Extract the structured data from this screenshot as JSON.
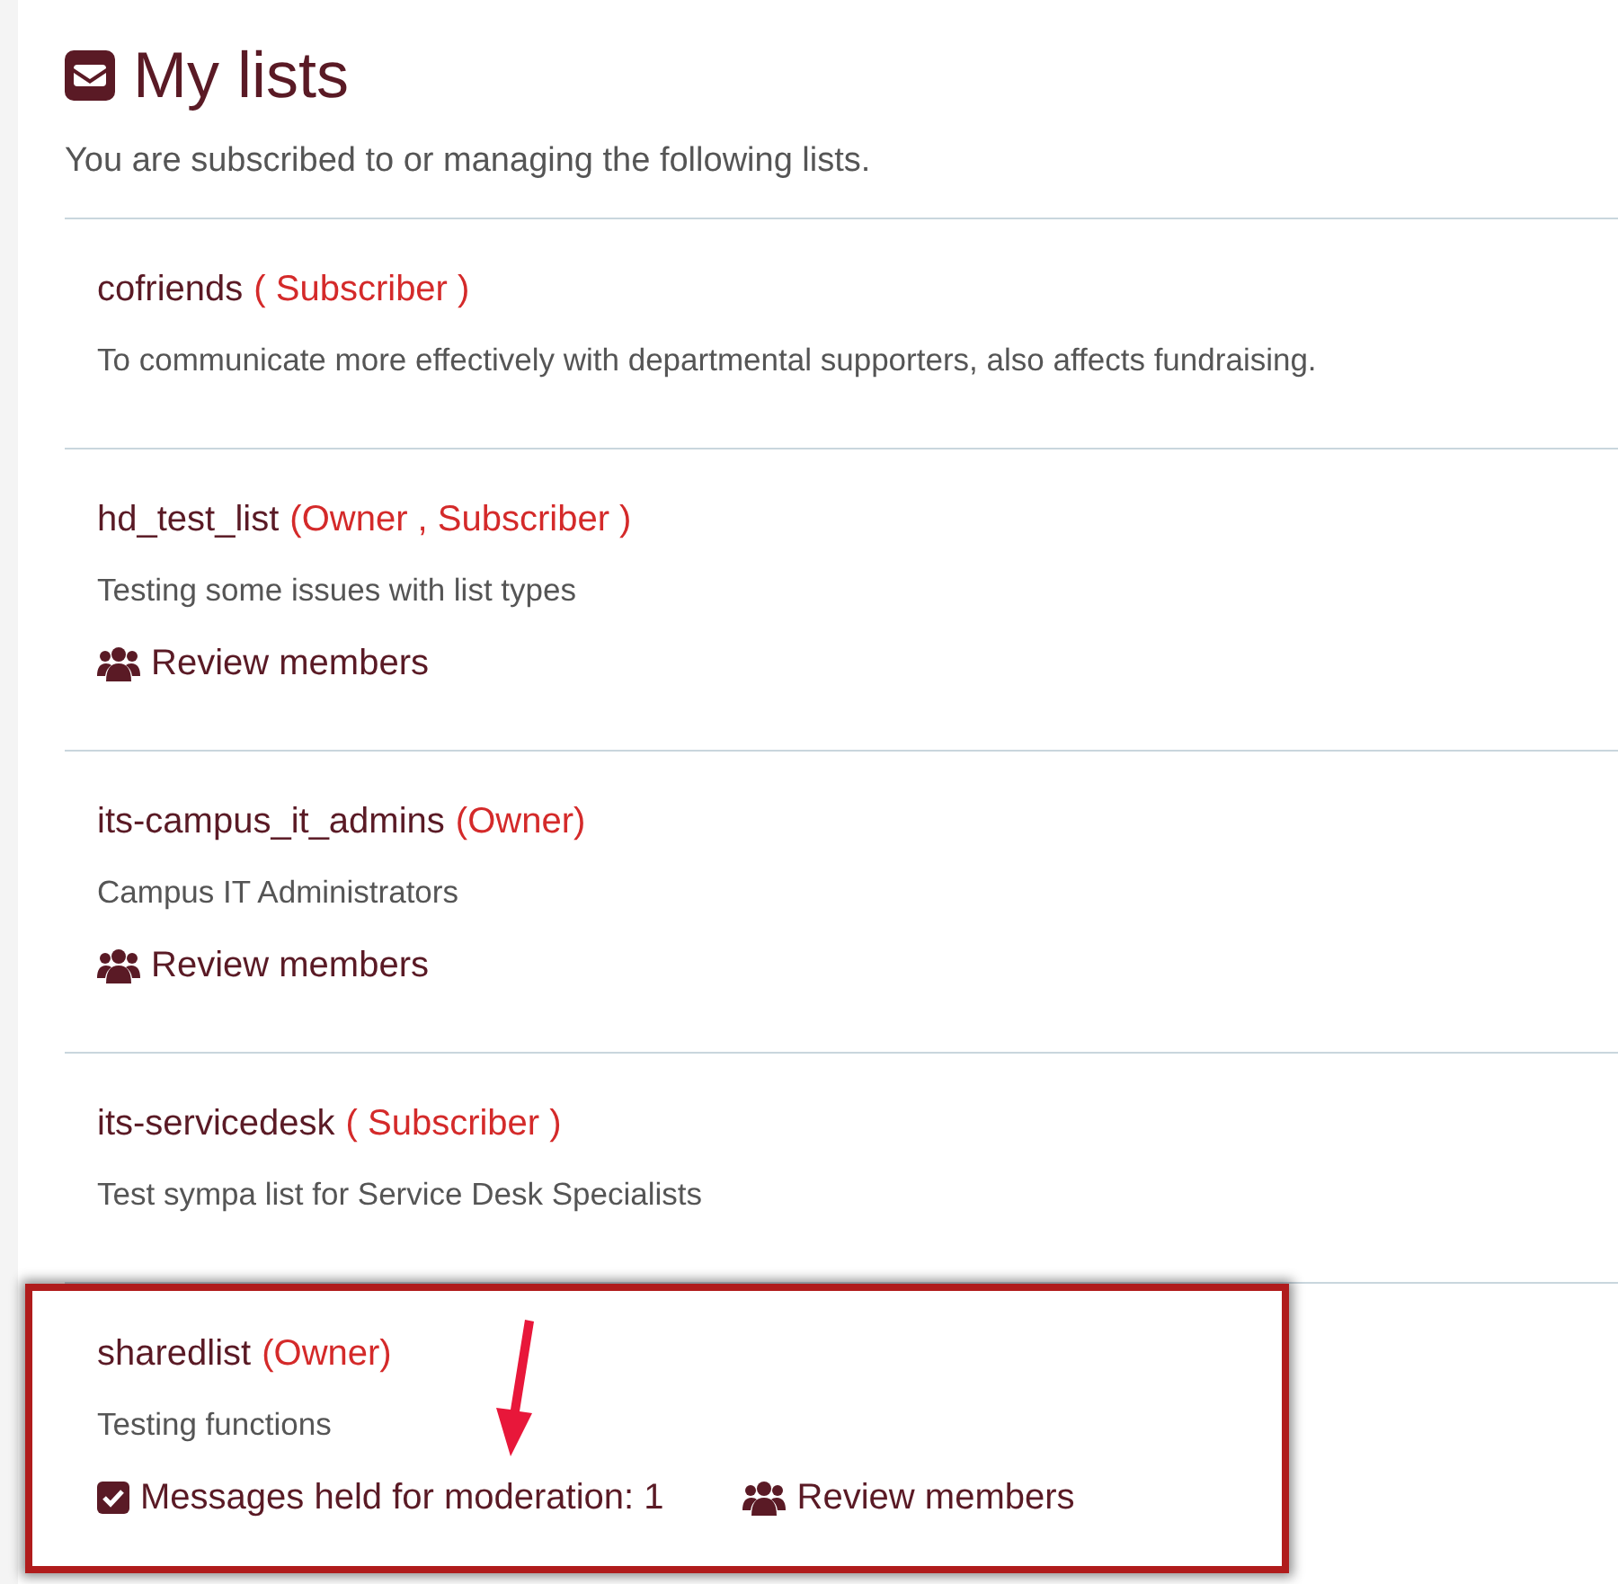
{
  "heading": {
    "title": "My lists"
  },
  "intro": "You are subscribed to or managing the following lists.",
  "lists": [
    {
      "name": "cofriends",
      "roles": "( Subscriber )",
      "description": "To communicate more effectively with departmental supporters, also affects fundraising.",
      "highlighted": false
    },
    {
      "name": "hd_test_list",
      "roles": "(Owner , Subscriber )",
      "description": "Testing some issues with list types",
      "actions": [
        {
          "kind": "members",
          "label": "Review members"
        }
      ],
      "highlighted": false
    },
    {
      "name": "its-campus_it_admins",
      "roles": "(Owner)",
      "description": "Campus IT Administrators",
      "actions": [
        {
          "kind": "members",
          "label": "Review members"
        }
      ],
      "highlighted": false
    },
    {
      "name": "its-servicedesk",
      "roles": "( Subscriber )",
      "description": "Test sympa list for Service Desk Specialists",
      "highlighted": false
    },
    {
      "name": "sharedlist",
      "roles": "(Owner)",
      "description": "Testing functions",
      "actions": [
        {
          "kind": "moderation",
          "label": "Messages held for moderation: 1"
        },
        {
          "kind": "members",
          "label": "Review members"
        }
      ],
      "highlighted": true
    }
  ]
}
